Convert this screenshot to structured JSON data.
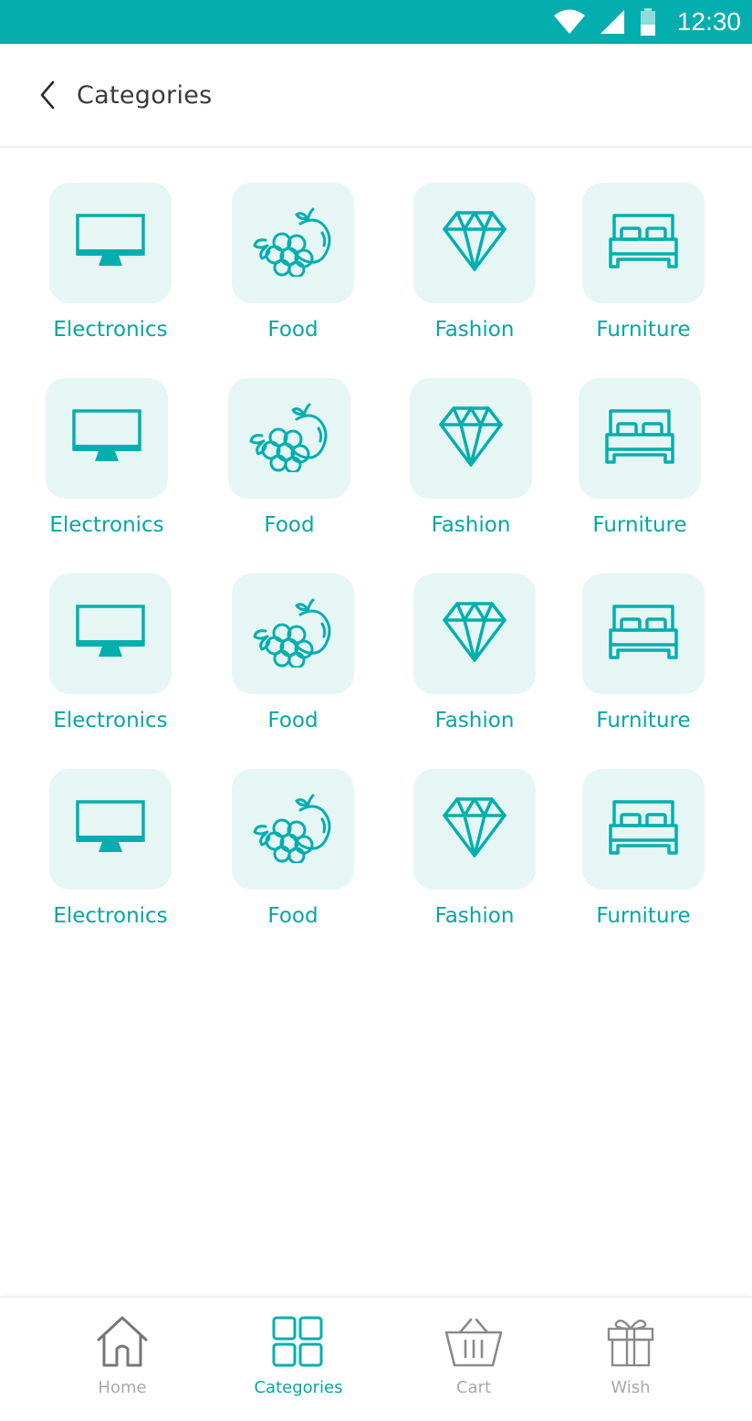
{
  "status_bar": {
    "time": "12:30"
  },
  "header": {
    "title": "Categories"
  },
  "categories": [
    {
      "label": "Electronics",
      "icon": "monitor-icon"
    },
    {
      "label": "Food",
      "icon": "fruits-icon"
    },
    {
      "label": "Fashion",
      "icon": "diamond-icon"
    },
    {
      "label": "Furniture",
      "icon": "bed-icon"
    }
  ],
  "grid": {
    "rows": [
      [
        "Electronics",
        "Food",
        "Fashion",
        "Furniture"
      ],
      [
        "Electronics",
        "Food",
        "Fashion",
        "Furniture"
      ],
      [
        "Electronics",
        "Food",
        "Fashion",
        "Furniture"
      ],
      [
        "Electronics",
        "Food",
        "Fashion",
        "Furniture"
      ]
    ]
  },
  "bottom_nav": {
    "items": [
      {
        "label": "Home",
        "icon": "home-icon",
        "active": false
      },
      {
        "label": "Categories",
        "icon": "grid-icon",
        "active": true
      },
      {
        "label": "Cart",
        "icon": "basket-icon",
        "active": false
      },
      {
        "label": "Wish",
        "icon": "gift-icon",
        "active": false
      }
    ]
  },
  "colors": {
    "accent": "#05aeae",
    "label": "#05a6a4",
    "tile_bg": "#e5f6f5",
    "nav_inactive": "#a9a9a9"
  }
}
